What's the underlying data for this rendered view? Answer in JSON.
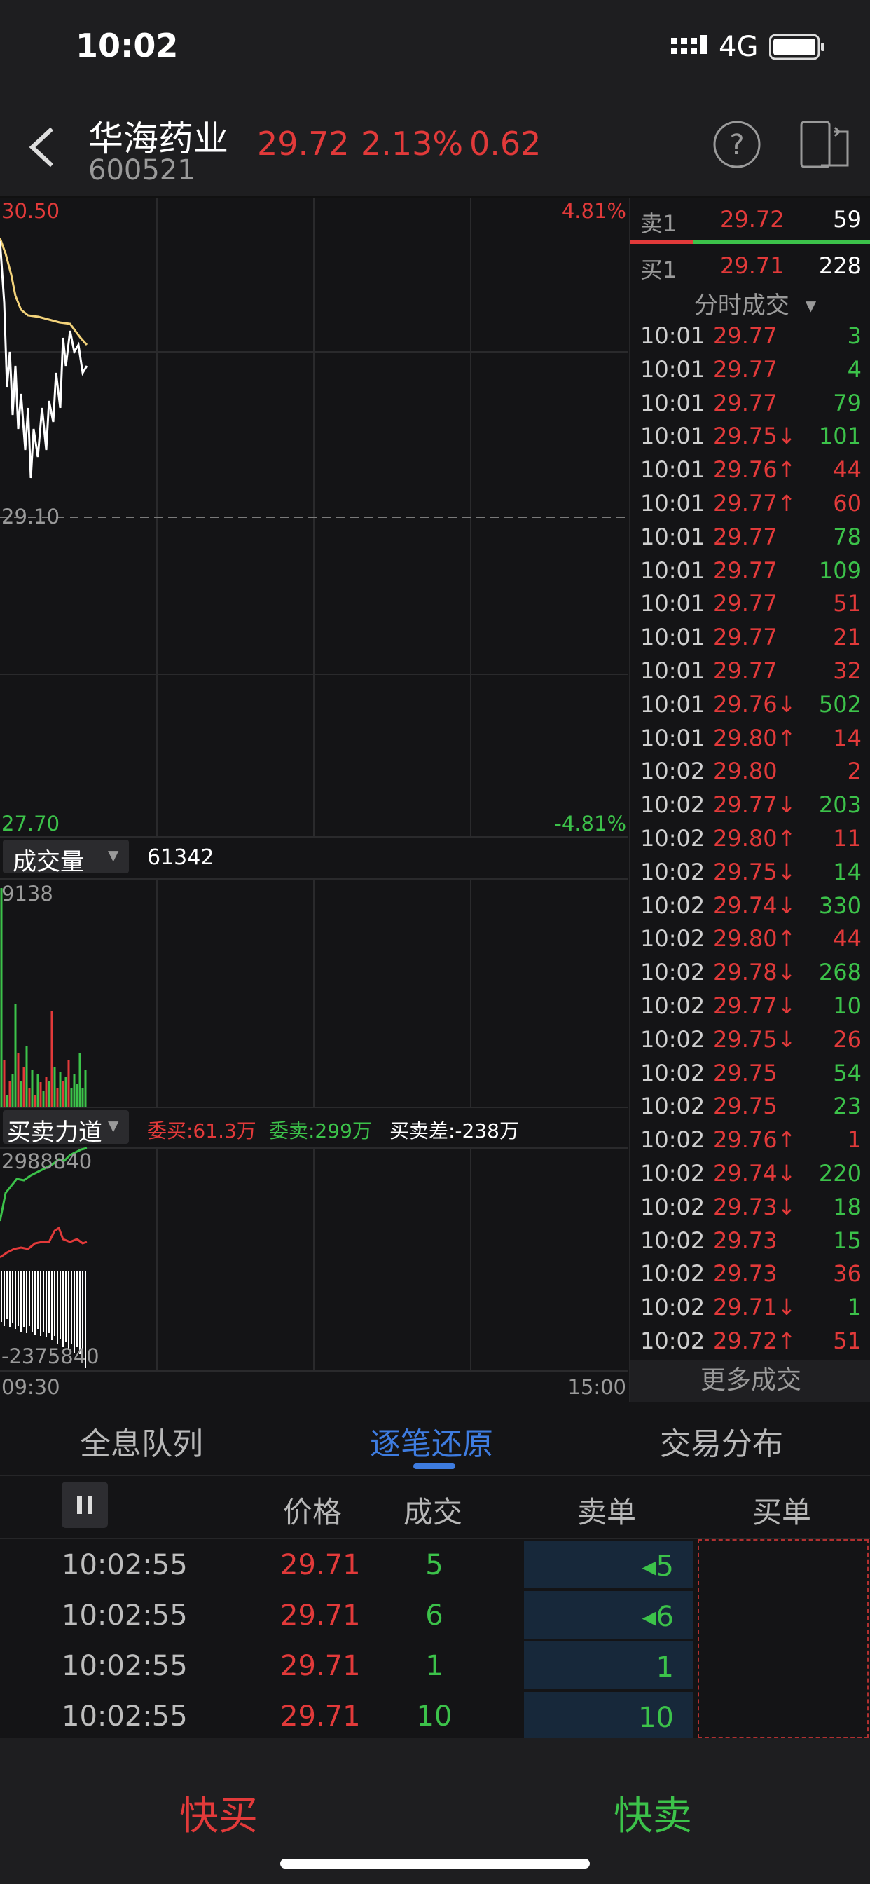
{
  "status_bar": {
    "time": "10:02",
    "network": "4G"
  },
  "header": {
    "name": "华海药业",
    "code": "600521",
    "price": "29.72",
    "change_pct": "2.13%",
    "change_amt": "0.62"
  },
  "chart": {
    "high": "30.50",
    "low": "27.70",
    "mid": "29.10",
    "up_pct": "4.81%",
    "down_pct": "-4.81%",
    "volume_selector": "成交量",
    "volume_value": "61342",
    "volume_max": "9138",
    "force_selector": "买卖力道",
    "force_buy": "委买:61.3万",
    "force_sell": "委卖:299万",
    "force_diff": "买卖差:-238万",
    "force_max": "2988840",
    "force_min": "-2375840",
    "time_start": "09:30",
    "time_end": "15:00"
  },
  "order_book": {
    "ask": {
      "label": "卖1",
      "price": "29.72",
      "vol": "59"
    },
    "bid": {
      "label": "买1",
      "price": "29.71",
      "vol": "228"
    }
  },
  "trade_list": {
    "title": "分时成交",
    "more": "更多成交",
    "rows": [
      {
        "time": "10:01",
        "price": "29.77",
        "vol": "3",
        "vol_color": "green"
      },
      {
        "time": "10:01",
        "price": "29.77",
        "vol": "4",
        "vol_color": "green"
      },
      {
        "time": "10:01",
        "price": "29.77",
        "vol": "79",
        "vol_color": "green"
      },
      {
        "time": "10:01",
        "price": "29.75↓",
        "vol": "101",
        "vol_color": "green"
      },
      {
        "time": "10:01",
        "price": "29.76↑",
        "vol": "44",
        "vol_color": "red"
      },
      {
        "time": "10:01",
        "price": "29.77↑",
        "vol": "60",
        "vol_color": "red"
      },
      {
        "time": "10:01",
        "price": "29.77",
        "vol": "78",
        "vol_color": "green"
      },
      {
        "time": "10:01",
        "price": "29.77",
        "vol": "109",
        "vol_color": "green"
      },
      {
        "time": "10:01",
        "price": "29.77",
        "vol": "51",
        "vol_color": "red"
      },
      {
        "time": "10:01",
        "price": "29.77",
        "vol": "21",
        "vol_color": "red"
      },
      {
        "time": "10:01",
        "price": "29.77",
        "vol": "32",
        "vol_color": "red"
      },
      {
        "time": "10:01",
        "price": "29.76↓",
        "vol": "502",
        "vol_color": "green"
      },
      {
        "time": "10:01",
        "price": "29.80↑",
        "vol": "14",
        "vol_color": "red"
      },
      {
        "time": "10:02",
        "price": "29.80",
        "vol": "2",
        "vol_color": "red"
      },
      {
        "time": "10:02",
        "price": "29.77↓",
        "vol": "203",
        "vol_color": "green"
      },
      {
        "time": "10:02",
        "price": "29.80↑",
        "vol": "11",
        "vol_color": "red"
      },
      {
        "time": "10:02",
        "price": "29.75↓",
        "vol": "14",
        "vol_color": "green"
      },
      {
        "time": "10:02",
        "price": "29.74↓",
        "vol": "330",
        "vol_color": "green"
      },
      {
        "time": "10:02",
        "price": "29.80↑",
        "vol": "44",
        "vol_color": "red"
      },
      {
        "time": "10:02",
        "price": "29.78↓",
        "vol": "268",
        "vol_color": "green"
      },
      {
        "time": "10:02",
        "price": "29.77↓",
        "vol": "10",
        "vol_color": "green"
      },
      {
        "time": "10:02",
        "price": "29.75↓",
        "vol": "26",
        "vol_color": "red"
      },
      {
        "time": "10:02",
        "price": "29.75",
        "vol": "54",
        "vol_color": "green"
      },
      {
        "time": "10:02",
        "price": "29.75",
        "vol": "23",
        "vol_color": "green"
      },
      {
        "time": "10:02",
        "price": "29.76↑",
        "vol": "1",
        "vol_color": "red"
      },
      {
        "time": "10:02",
        "price": "29.74↓",
        "vol": "220",
        "vol_color": "green"
      },
      {
        "time": "10:02",
        "price": "29.73↓",
        "vol": "18",
        "vol_color": "green"
      },
      {
        "time": "10:02",
        "price": "29.73",
        "vol": "15",
        "vol_color": "green"
      },
      {
        "time": "10:02",
        "price": "29.73",
        "vol": "36",
        "vol_color": "red"
      },
      {
        "time": "10:02",
        "price": "29.71↓",
        "vol": "1",
        "vol_color": "green"
      },
      {
        "time": "10:02",
        "price": "29.72↑",
        "vol": "51",
        "vol_color": "red"
      }
    ]
  },
  "tabs": [
    "全息队列",
    "逐笔还原",
    "交易分布"
  ],
  "tick_table": {
    "headers": {
      "price": "价格",
      "deal": "成交",
      "sell": "卖单",
      "buy": "买单"
    },
    "rows": [
      {
        "time": "10:02:55",
        "price": "29.71",
        "deal": "5",
        "sell": "◂5"
      },
      {
        "time": "10:02:55",
        "price": "29.71",
        "deal": "6",
        "sell": "◂6"
      },
      {
        "time": "10:02:55",
        "price": "29.71",
        "deal": "1",
        "sell": "1"
      },
      {
        "time": "10:02:55",
        "price": "29.71",
        "deal": "10",
        "sell": "10"
      }
    ]
  },
  "actions": {
    "buy": "快买",
    "sell": "快卖"
  }
}
